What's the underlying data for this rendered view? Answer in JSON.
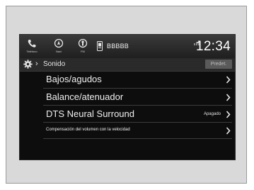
{
  "statusbar": {
    "buttons": [
      {
        "icon": "phone-icon",
        "caption": "Teléfono"
      },
      {
        "icon": "navi-icon",
        "caption": "Navi"
      },
      {
        "icon": "fm-icon",
        "caption": "FM"
      }
    ],
    "device_name": "BBBBB",
    "time": "12:34"
  },
  "titlebar": {
    "title": "Sonido",
    "default_button": "Predet."
  },
  "menu": {
    "items": [
      {
        "label": "Bajos/agudos",
        "value": ""
      },
      {
        "label": "Balance/atenuador",
        "value": ""
      },
      {
        "label": "DTS Neural Surround",
        "value": "Apagado"
      },
      {
        "label": "Compensación del volumen con la velocidad",
        "value": ""
      }
    ]
  },
  "colors": {
    "screen_bg": "#0d0d0d",
    "text": "#f0f0f0",
    "divider": "#3c3c3c"
  }
}
